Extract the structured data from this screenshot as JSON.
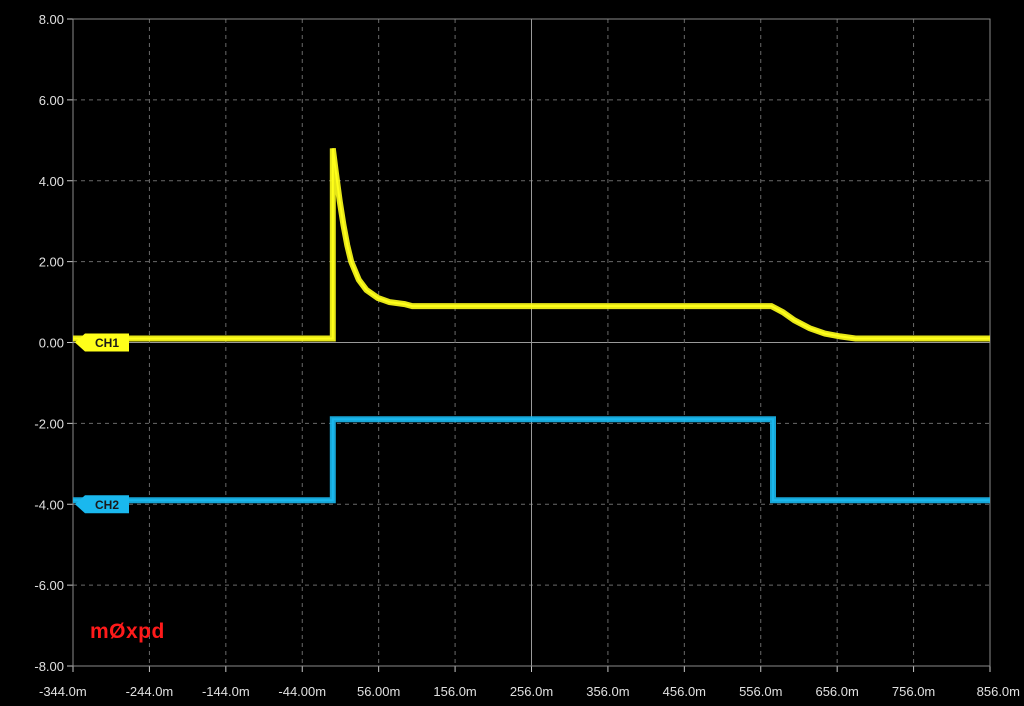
{
  "chart_data": {
    "type": "line",
    "title": "",
    "xlabel": "",
    "ylabel": "",
    "xlim": [
      -344,
      856
    ],
    "ylim": [
      -8,
      8
    ],
    "x_unit": "ms",
    "grid": true,
    "y_ticks": [
      "8.00",
      "6.00",
      "4.00",
      "2.00",
      "0.00",
      "-2.00",
      "-4.00",
      "-6.00",
      "-8.00"
    ],
    "y_tick_values": [
      8,
      6,
      4,
      2,
      0,
      -2,
      -4,
      -6,
      -8
    ],
    "x_ticks": [
      "-344.0m",
      "-244.0m",
      "-144.0m",
      "-44.00m",
      "56.00m",
      "156.0m",
      "256.0m",
      "356.0m",
      "456.0m",
      "556.0m",
      "656.0m",
      "756.0m",
      "856.0m"
    ],
    "x_tick_values": [
      -344,
      -244,
      -144,
      -44,
      56,
      156,
      256,
      356,
      456,
      556,
      656,
      756,
      856
    ],
    "series": [
      {
        "name": "CH1",
        "color": "#ffff1a",
        "marker_level": 0,
        "points": [
          [
            -344,
            0.1
          ],
          [
            -4,
            0.1
          ],
          [
            -4,
            4.8
          ],
          [
            0,
            4.2
          ],
          [
            5,
            3.5
          ],
          [
            10,
            2.9
          ],
          [
            15,
            2.4
          ],
          [
            20,
            2.0
          ],
          [
            30,
            1.55
          ],
          [
            40,
            1.3
          ],
          [
            55,
            1.1
          ],
          [
            70,
            1.0
          ],
          [
            90,
            0.95
          ],
          [
            100,
            0.9
          ],
          [
            130,
            0.9
          ],
          [
            300,
            0.9
          ],
          [
            450,
            0.9
          ],
          [
            570,
            0.9
          ],
          [
            585,
            0.75
          ],
          [
            600,
            0.55
          ],
          [
            620,
            0.35
          ],
          [
            640,
            0.22
          ],
          [
            660,
            0.15
          ],
          [
            680,
            0.1
          ],
          [
            856,
            0.1
          ]
        ]
      },
      {
        "name": "CH2",
        "color": "#1ab8ee",
        "marker_level": -4,
        "points": [
          [
            -344,
            -3.9
          ],
          [
            -4,
            -3.9
          ],
          [
            -4,
            -1.9
          ],
          [
            572,
            -1.9
          ],
          [
            572,
            -3.9
          ],
          [
            856,
            -3.9
          ]
        ]
      }
    ]
  },
  "watermark": "mØxpd"
}
